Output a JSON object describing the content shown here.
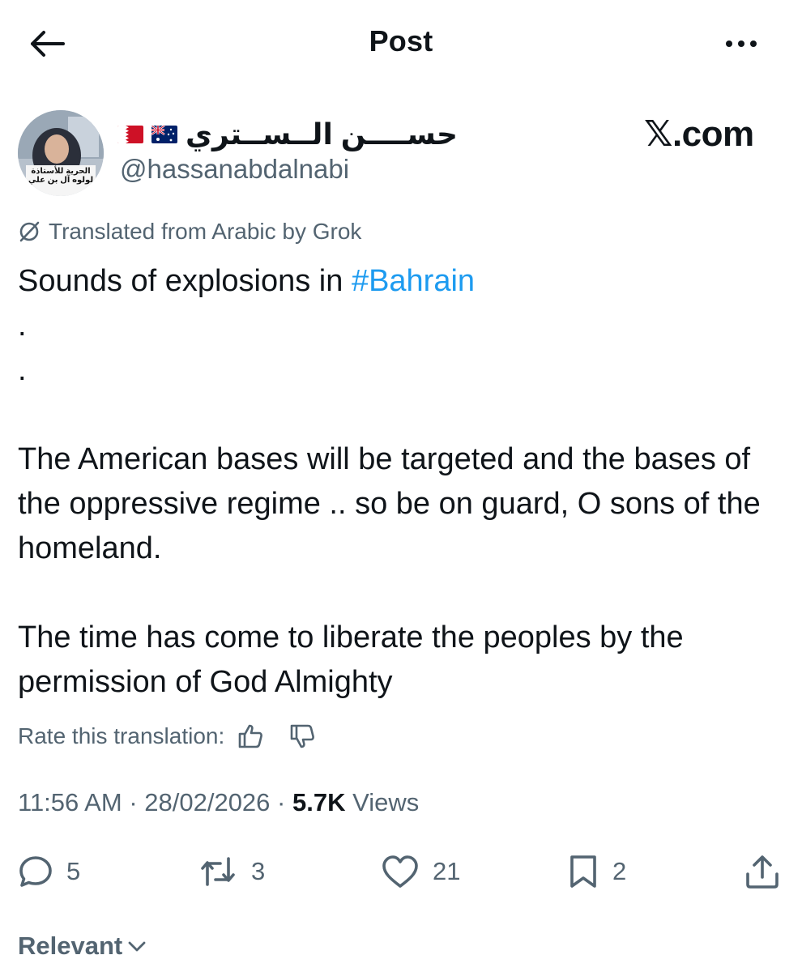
{
  "header": {
    "title": "Post",
    "back_icon": "arrow-left-icon",
    "more_icon": "more-horizontal-icon"
  },
  "author": {
    "name": "حســــن الــســتري",
    "flags": [
      "Bahrain flag",
      "Australia flag"
    ],
    "handle": "@hassanabdalnabi",
    "avatar_caption_line1": "الحرية للأستاذة",
    "avatar_caption_line2": "لولوه آل بن علي"
  },
  "watermark": "𝕏.com",
  "translation": {
    "note": "Translated from Arabic by Grok",
    "icon": "grok-icon"
  },
  "post": {
    "line1_prefix": "Sounds of explosions in ",
    "hashtag": "#Bahrain",
    "dot1": ".",
    "dot2": ".",
    "paragraph2": "The American bases will be targeted and the bases of the oppressive regime .. so be on guard, O sons of the homeland.",
    "paragraph3": "The time has come to liberate the peoples by the permission of God Almighty"
  },
  "rate": {
    "label": "Rate this translation:",
    "thumbs_up_icon": "thumbs-up-icon",
    "thumbs_down_icon": "thumbs-down-icon"
  },
  "meta": {
    "time": "11:56 AM",
    "date": "28/02/2026",
    "views_count": "5.7K",
    "views_label": "Views",
    "separator": "·"
  },
  "actions": {
    "replies": "5",
    "reposts": "3",
    "likes": "21",
    "bookmarks": "2"
  },
  "sort": {
    "label": "Relevant"
  },
  "colors": {
    "text": "#0f1419",
    "secondary": "#536471",
    "link": "#1d9bf0"
  }
}
